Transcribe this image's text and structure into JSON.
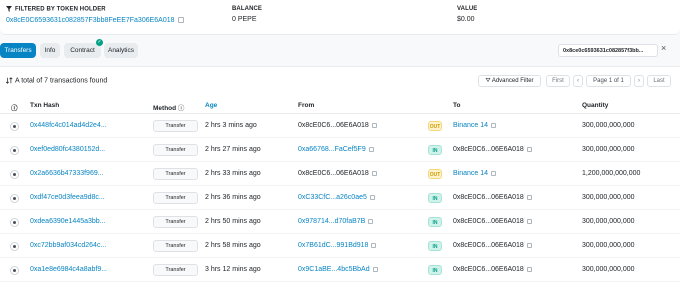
{
  "summary": {
    "filter_label": "FILTERED BY TOKEN HOLDER",
    "holder_address": "0x8cE0C6593631c082857F3bb8FeEE7Fa306E6A018",
    "balance_label": "BALANCE",
    "balance_value": "0 PEPE",
    "value_label": "VALUE",
    "value_value": "$0.00"
  },
  "tabs": [
    {
      "label": "Transfers",
      "active": true
    },
    {
      "label": "Info"
    },
    {
      "label": "Contract",
      "verified": true
    },
    {
      "label": "Analytics"
    }
  ],
  "filter_chip": {
    "text": "0x8ce0c6593631c082857f3bb...",
    "close": "×"
  },
  "table": {
    "total_text": "A total of 7 transactions found",
    "advanced_filter": "Advanced Filter",
    "pager": {
      "first": "First",
      "prev": "‹",
      "page": "Page 1 of 1",
      "next": "›",
      "last": "Last"
    },
    "headers": {
      "info": "ⓘ",
      "hash": "Txn Hash",
      "method": "Method",
      "age": "Age",
      "from": "From",
      "to": "To",
      "quantity": "Quantity"
    },
    "rows": [
      {
        "hash": "0x448fc4c014ad4d2e4...",
        "method": "Transfer",
        "age": "2 hrs 3 mins ago",
        "from": "0x8cE0C6...06E6A018",
        "from_link": false,
        "dir": "OUT",
        "to": "Binance 14",
        "to_link": true,
        "qty": "300,000,000,000"
      },
      {
        "hash": "0xef0ed80fc4380152d...",
        "method": "Transfer",
        "age": "2 hrs 27 mins ago",
        "from": "0xa66768...FaCef5F9",
        "from_link": true,
        "dir": "IN",
        "to": "0x8cE0C6...06E6A018",
        "to_link": false,
        "qty": "300,000,000,000"
      },
      {
        "hash": "0x2a6636b47333f969...",
        "method": "Transfer",
        "age": "2 hrs 33 mins ago",
        "from": "0x8cE0C6...06E6A018",
        "from_link": false,
        "dir": "OUT",
        "to": "Binance 14",
        "to_link": true,
        "qty": "1,200,000,000,000"
      },
      {
        "hash": "0xdf47ce0d3feea9d8c...",
        "method": "Transfer",
        "age": "2 hrs 36 mins ago",
        "from": "0xC33CfC...a26c0ae5",
        "from_link": true,
        "dir": "IN",
        "to": "0x8cE0C6...06E6A018",
        "to_link": false,
        "qty": "300,000,000,000"
      },
      {
        "hash": "0xdea6390e1445a3bb...",
        "method": "Transfer",
        "age": "2 hrs 50 mins ago",
        "from": "0x978714...d70faB7B",
        "from_link": true,
        "dir": "IN",
        "to": "0x8cE0C6...06E6A018",
        "to_link": false,
        "qty": "300,000,000,000"
      },
      {
        "hash": "0xc72bb9af034cd264c...",
        "method": "Transfer",
        "age": "2 hrs 58 mins ago",
        "from": "0x7B61dC...991Bd918",
        "from_link": true,
        "dir": "IN",
        "to": "0x8cE0C6...06E6A018",
        "to_link": false,
        "qty": "300,000,000,000"
      },
      {
        "hash": "0xa1e8e6984c4a8abf9...",
        "method": "Transfer",
        "age": "3 hrs 12 mins ago",
        "from": "0x9C1aBE...4bc5BbAd",
        "from_link": true,
        "dir": "IN",
        "to": "0x8cE0C6...06E6A018",
        "to_link": false,
        "qty": "300,000,000,000"
      }
    ]
  },
  "colors": {
    "link": "#0784c3",
    "in": "#00a186",
    "out": "#cc9a06"
  }
}
